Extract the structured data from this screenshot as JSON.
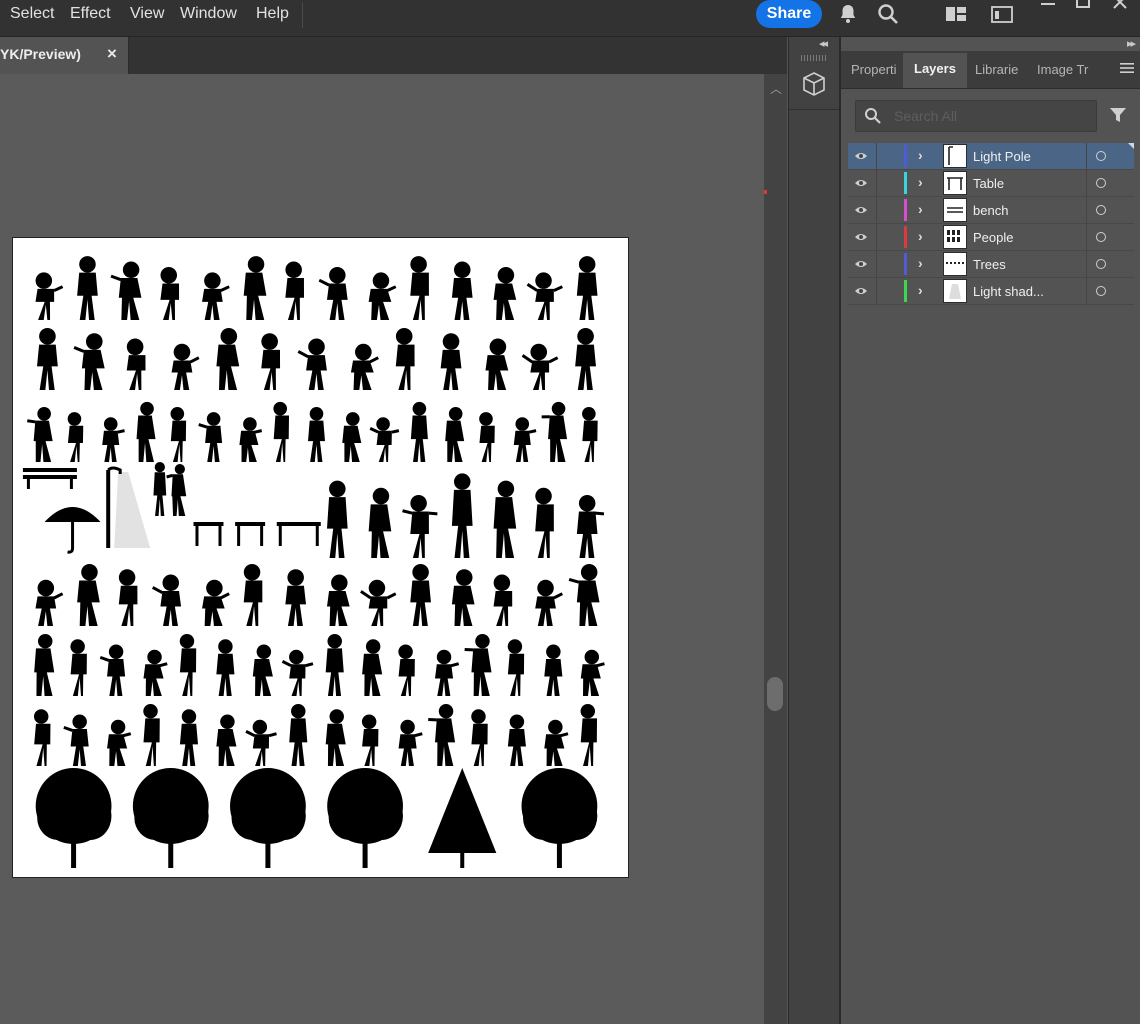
{
  "menu": {
    "items": [
      "Select",
      "Effect",
      "View",
      "Window",
      "Help"
    ],
    "share_label": "Share",
    "icons": [
      "bell-icon",
      "search-icon",
      "workspace-icon",
      "arrange-icon"
    ]
  },
  "document": {
    "tab_title": "YK/Preview)",
    "close_glyph": "×"
  },
  "panel": {
    "tabs": [
      "Properti",
      "Layers",
      "Librarie",
      "Image Tr"
    ],
    "active_tab": "Layers",
    "search_placeholder": "Search All",
    "layers": [
      {
        "name": "Light Pole",
        "color": "#4f5cd8",
        "selected": true,
        "thumb": "pole"
      },
      {
        "name": "Table",
        "color": "#36d6dc",
        "selected": false,
        "thumb": "table"
      },
      {
        "name": "bench",
        "color": "#d54fd0",
        "selected": false,
        "thumb": "bench"
      },
      {
        "name": "People",
        "color": "#dd3b3b",
        "selected": false,
        "thumb": "people"
      },
      {
        "name": "Trees",
        "color": "#4f5cd8",
        "selected": false,
        "thumb": "trees"
      },
      {
        "name": "Light shad...",
        "color": "#3bd84f",
        "selected": false,
        "thumb": "shade"
      }
    ]
  },
  "colors": {
    "accent": "#1473e6",
    "selected_row": "#4b6586",
    "canvas_bg": "#5b5b5b",
    "chrome_dark": "#323232"
  },
  "artboard": {
    "rows": [
      [
        "person",
        "person",
        "person",
        "person",
        "person",
        "person",
        "person",
        "person",
        "person",
        "person",
        "person",
        "person",
        "person",
        "person"
      ],
      [
        "person",
        "person",
        "person",
        "person",
        "person",
        "person",
        "person",
        "person",
        "person",
        "person",
        "person",
        "person",
        "person"
      ],
      [
        "person",
        "person",
        "person",
        "person",
        "person",
        "person",
        "person",
        "person",
        "person",
        "person",
        "person",
        "person",
        "person",
        "person",
        "person",
        "person",
        "person"
      ],
      [
        "bench",
        "umbrella",
        "light-pole",
        "couple",
        "table",
        "table",
        "table",
        "person",
        "person",
        "person",
        "person",
        "person",
        "person",
        "person"
      ],
      [
        "person",
        "person",
        "person",
        "person",
        "person",
        "person",
        "person",
        "person",
        "person",
        "person",
        "person",
        "person",
        "person",
        "person"
      ],
      [
        "person",
        "person",
        "person",
        "person",
        "person",
        "person",
        "person",
        "person",
        "person",
        "person",
        "person",
        "person",
        "person",
        "person",
        "person",
        "person"
      ],
      [
        "person",
        "person",
        "person",
        "person",
        "person",
        "person",
        "person",
        "person",
        "person",
        "person",
        "person",
        "person",
        "person",
        "person",
        "person",
        "person"
      ],
      [
        "tree",
        "tree",
        "tree",
        "tree",
        "pine-tree",
        "tree"
      ]
    ]
  }
}
